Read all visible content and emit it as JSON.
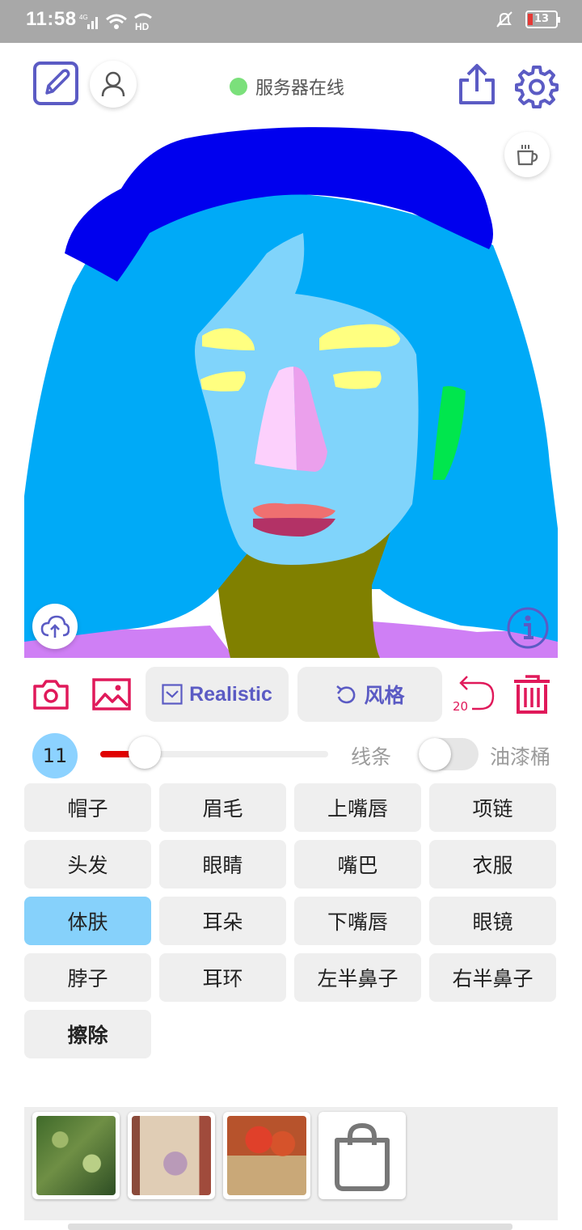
{
  "status_bar": {
    "time": "11:58",
    "network": "4G",
    "hd": "HD",
    "battery": "13"
  },
  "toolbar": {
    "server_status": "服务器在线",
    "server_color": "#7be07b"
  },
  "actions": {
    "mode_label": "Realistic",
    "style_label": "风格",
    "undo_count": "20"
  },
  "slider": {
    "brush_size": "11",
    "brush_level": 0.18,
    "line_label": "线条",
    "bucket_label": "油漆桶",
    "bucket_on": false
  },
  "labels": [
    {
      "text": "帽子",
      "active": false
    },
    {
      "text": "眉毛",
      "active": false
    },
    {
      "text": "上嘴唇",
      "active": false
    },
    {
      "text": "项链",
      "active": false
    },
    {
      "text": "头发",
      "active": false
    },
    {
      "text": "眼睛",
      "active": false
    },
    {
      "text": "嘴巴",
      "active": false
    },
    {
      "text": "衣服",
      "active": false
    },
    {
      "text": "体肤",
      "active": true
    },
    {
      "text": "耳朵",
      "active": false
    },
    {
      "text": "下嘴唇",
      "active": false
    },
    {
      "text": "眼镜",
      "active": false
    },
    {
      "text": "脖子",
      "active": false
    },
    {
      "text": "耳环",
      "active": false
    },
    {
      "text": "左半鼻子",
      "active": false
    },
    {
      "text": "右半鼻子",
      "active": false
    },
    {
      "text": "擦除",
      "active": false,
      "bold": true
    }
  ],
  "colors": {
    "accent": "#5b5bc4",
    "danger": "#e0195a",
    "active_chip": "#86d1fb"
  }
}
